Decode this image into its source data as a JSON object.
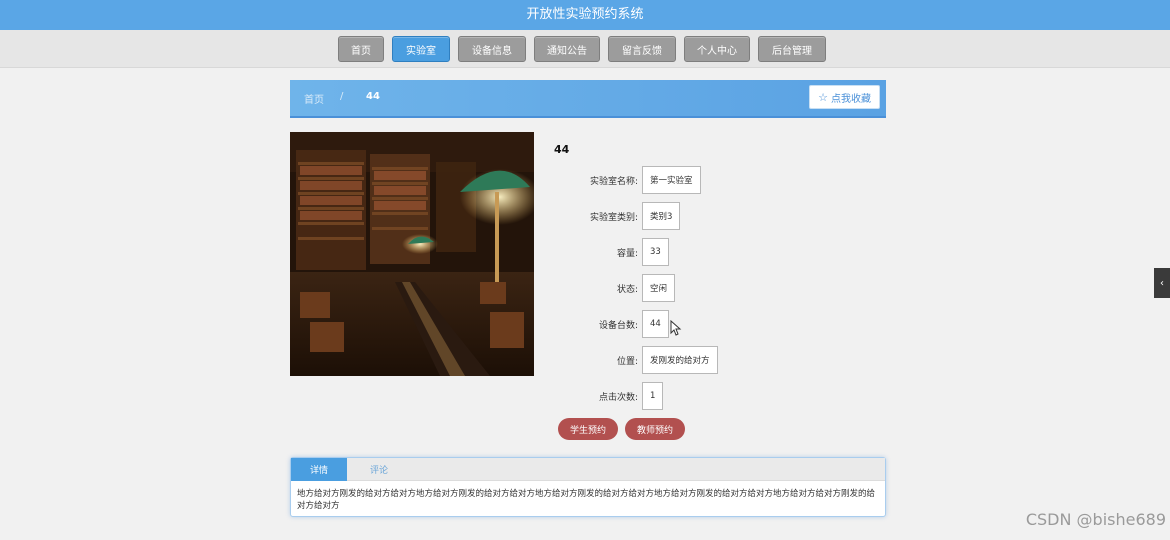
{
  "header": {
    "title": "开放性实验预约系统"
  },
  "nav": {
    "items": [
      {
        "label": "首页",
        "width": 46
      },
      {
        "label": "实验室",
        "width": 58,
        "active": true
      },
      {
        "label": "设备信息",
        "width": 68
      },
      {
        "label": "通知公告",
        "width": 66
      },
      {
        "label": "留言反馈",
        "width": 68
      },
      {
        "label": "个人中心",
        "width": 66
      },
      {
        "label": "后台管理",
        "width": 68
      }
    ]
  },
  "breadcrumb": {
    "home": "首页",
    "separator": "/",
    "current": "44"
  },
  "favorite": {
    "icon": "star-outline-icon",
    "label": "点我收藏"
  },
  "detail": {
    "title": "44",
    "fields": [
      {
        "label": "实验室名称:",
        "value": "第一实验室"
      },
      {
        "label": "实验室类别:",
        "value": "类别3"
      },
      {
        "label": "容量:",
        "value": "33"
      },
      {
        "label": "状态:",
        "value": "空闲"
      },
      {
        "label": "设备台数:",
        "value": "44"
      },
      {
        "label": "位置:",
        "value": "发刚发的给对方"
      },
      {
        "label": "点击次数:",
        "value": "1"
      }
    ]
  },
  "actions": {
    "student_reserve": "学生预约",
    "teacher_reserve": "教师预约"
  },
  "tabs": {
    "detail_label": "详情",
    "comment_label": "评论",
    "content": "地方给对方刚发的给对方给对方地方给对方刚发的给对方给对方地方给对方刚发的给对方给对方地方给对方刚发的给对方给对方地方给对方给对方刚发的给对方给对方"
  },
  "watermark": "CSDN @bishe689",
  "colors": {
    "header": "#5aa6e6",
    "active_nav": "#4a9ee0",
    "reserve_button": "#b2504f"
  }
}
